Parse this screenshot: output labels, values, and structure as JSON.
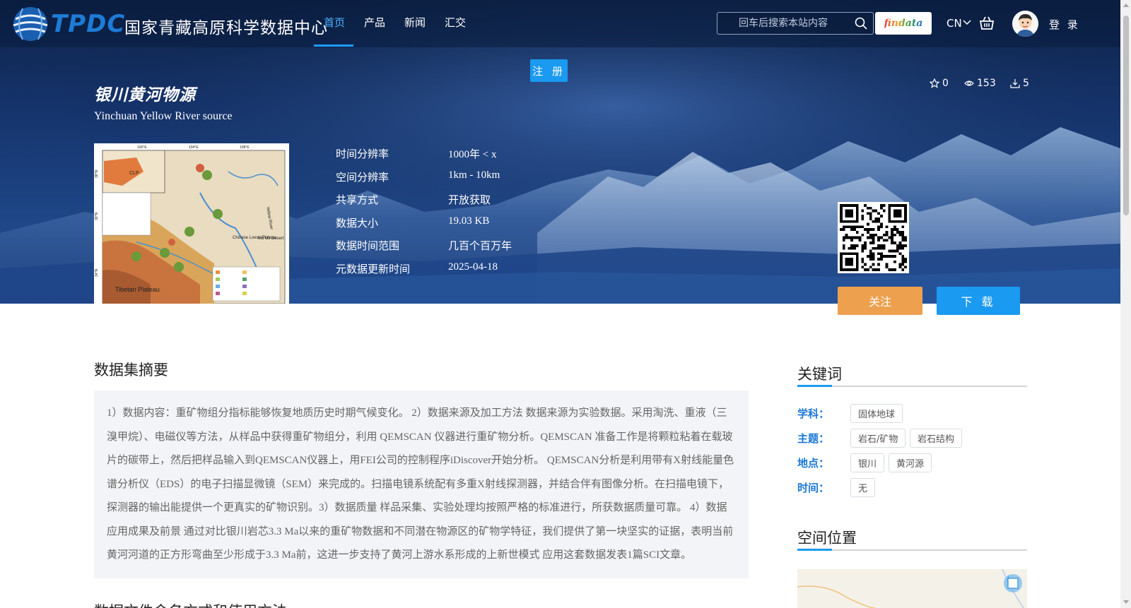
{
  "header": {
    "logo_text": "TPDC",
    "logo_cn": "国家青藏高原科学数据中心",
    "nav": [
      {
        "label": "首页",
        "active": true
      },
      {
        "label": "产品",
        "active": false
      },
      {
        "label": "新闻",
        "active": false
      },
      {
        "label": "汇交",
        "active": false
      }
    ],
    "search_placeholder": "回车后搜索本站内容",
    "findata_label": "findata",
    "lang": "CN",
    "login": "登 录",
    "register": "注 册"
  },
  "dataset": {
    "title_cn": "银川黄河物源",
    "title_en": "Yinchuan Yellow River source",
    "stars": "0",
    "views": "153",
    "downloads": "5",
    "meta": [
      {
        "label": "时间分辨率",
        "value": "1000年 < x"
      },
      {
        "label": "空间分辨率",
        "value": "1km - 10km"
      },
      {
        "label": "共享方式",
        "value": "开放获取"
      },
      {
        "label": "数据大小",
        "value": "19.03 KB"
      },
      {
        "label": "数据时间范围",
        "value": "几百个百万年"
      },
      {
        "label": "元数据更新时间",
        "value": "2025-04-18"
      }
    ],
    "follow": "关注",
    "download": "下 载"
  },
  "thumbnail": {
    "top_ticks": [
      "100°E",
      "104°E",
      "108°E"
    ],
    "side_ticks": [
      "38°N",
      "36°N",
      "34°N"
    ],
    "labels": [
      "CLP",
      "Mu Us Desert",
      "Chinese Loess Plateau",
      "Tibetan Plateau",
      "Yellow River"
    ]
  },
  "abstract": {
    "title": "数据集摘要",
    "text": "1）数据内容：重矿物组分指标能够恢复地质历史时期气候变化。 2）数据来源及加工方法 数据来源为实验数据。采用淘洗、重液（三溴甲烷）、电磁仪等方法，从样品中获得重矿物组分，利用 QEMSCAN 仪器进行重矿物分析。QEMSCAN 准备工作是将颗粒粘着在载玻片的碳带上，然后把样品输入到QEMSCAN仪器上，用FEI公司的控制程序iDiscover开始分析。 QEMSCAN分析是利用带有X射线能量色谱分析仪（EDS）的电子扫描显微镜（SEM）来完成的。扫描电镜系统配有多重X射线探测器，并结合伴有图像分析。在扫描电镜下，探测器的输出能提供一个更真实的矿物识别。3）数据质量 样品采集、实验处理均按照严格的标准进行，所获数据质量可靠。 4）数据应用成果及前景 通过对比银川岩芯3.3 Ma以来的重矿物数据和不同潜在物源区的矿物学特征，我们提供了第一块坚实的证据，表明当前黄河河道的正方形弯曲至少形成于3.3 Ma前，这进一步支持了黄河上游水系形成的上新世模式 应用这套数据发表1篇SCI文章。"
  },
  "keywords": {
    "title": "关键词",
    "rows": [
      {
        "label": "学科：",
        "tags": [
          "固体地球"
        ]
      },
      {
        "label": "主题：",
        "tags": [
          "岩石/矿物",
          "岩石结构"
        ]
      },
      {
        "label": "地点：",
        "tags": [
          "银川",
          "黄河源"
        ]
      },
      {
        "label": "时间：",
        "tags": [
          "无"
        ]
      }
    ]
  },
  "spatial": {
    "title": "空间位置"
  },
  "next_section": {
    "title": "数据文件命名方式和使用方法"
  }
}
